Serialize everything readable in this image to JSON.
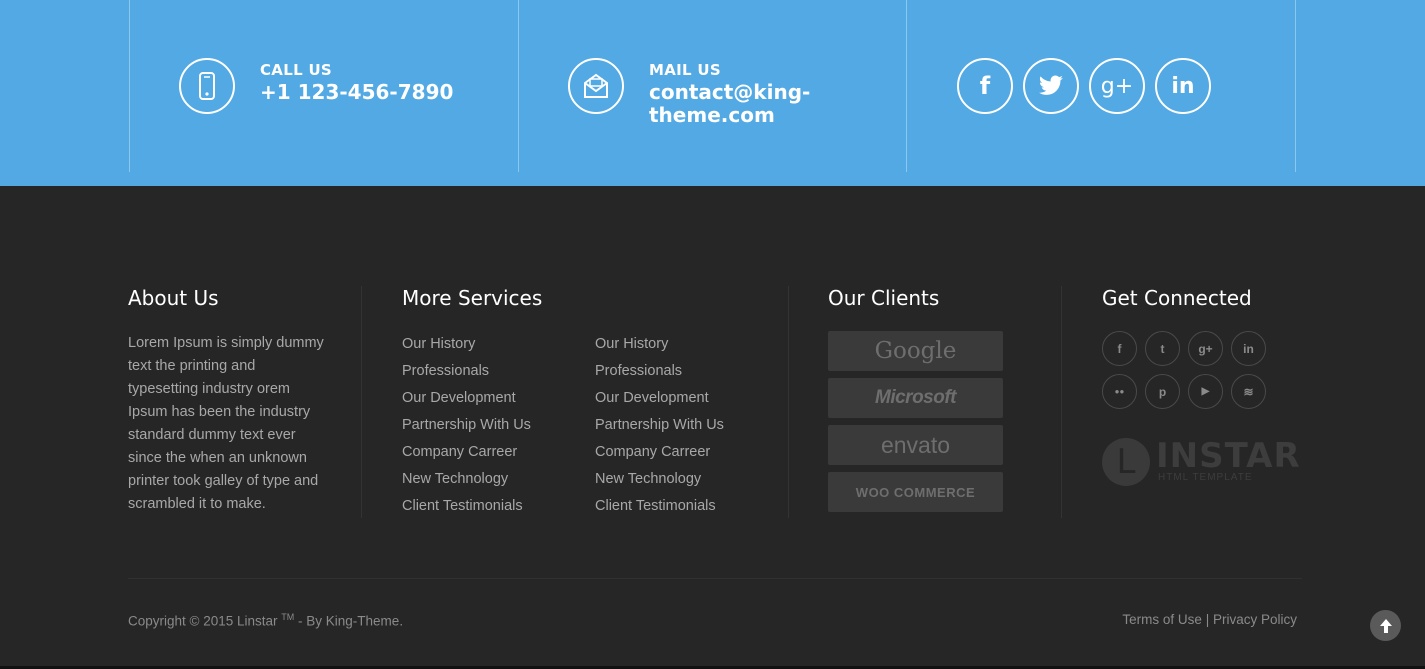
{
  "contact": {
    "call_label": "CALL US",
    "call_value": "+1 123-456-7890",
    "mail_label": "MAIL US",
    "mail_value_line1": "contact@king-",
    "mail_value_line2": "theme.com",
    "social": [
      {
        "icon": "facebook-icon",
        "glyph": "f"
      },
      {
        "icon": "twitter-icon",
        "glyph": "🐦"
      },
      {
        "icon": "google-plus-icon",
        "glyph": "g+"
      },
      {
        "icon": "linkedin-icon",
        "glyph": "in"
      }
    ]
  },
  "about": {
    "title": "About Us",
    "text": "Lorem Ipsum is simply dummy text the printing and typesetting industry orem Ipsum has been the industry standard dummy text ever since the when an unknown printer took galley of type and scrambled it to make."
  },
  "services": {
    "title": "More Services",
    "col1": [
      "Our History",
      "Professionals",
      "Our Development",
      "Partnership With Us",
      "Company Carreer",
      "New Technology",
      "Client Testimonials"
    ],
    "col2": [
      "Our History",
      "Professionals",
      "Our Development",
      "Partnership With Us",
      "Company Carreer",
      "New Technology",
      "Client Testimonials"
    ]
  },
  "clients": {
    "title": "Our Clients",
    "logos": [
      "Google",
      "Microsoft",
      "envato",
      "WOO COMMERCE"
    ]
  },
  "connected": {
    "title": "Get Connected",
    "icons": [
      {
        "icon": "facebook-icon",
        "glyph": "f"
      },
      {
        "icon": "twitter-icon",
        "glyph": "t"
      },
      {
        "icon": "google-plus-icon",
        "glyph": "g+"
      },
      {
        "icon": "linkedin-icon",
        "glyph": "in"
      },
      {
        "icon": "flickr-icon",
        "glyph": "●●"
      },
      {
        "icon": "pinterest-icon",
        "glyph": "p"
      },
      {
        "icon": "youtube-icon",
        "glyph": "▶"
      },
      {
        "icon": "rss-icon",
        "glyph": "≋"
      }
    ],
    "brand_letter": "L",
    "brand_name": "INSTAR",
    "brand_sub": "HTML TEMPLATE"
  },
  "footer": {
    "copyright_pre": "Copyright © 2015 Linstar ",
    "copyright_tm": "TM",
    "copyright_post": " - By King-Theme.",
    "terms": "Terms of Use",
    "separator": "|",
    "privacy": "Privacy Policy"
  },
  "colors": {
    "contact_bar": "#52a9e3",
    "footer_bg": "#262626"
  }
}
